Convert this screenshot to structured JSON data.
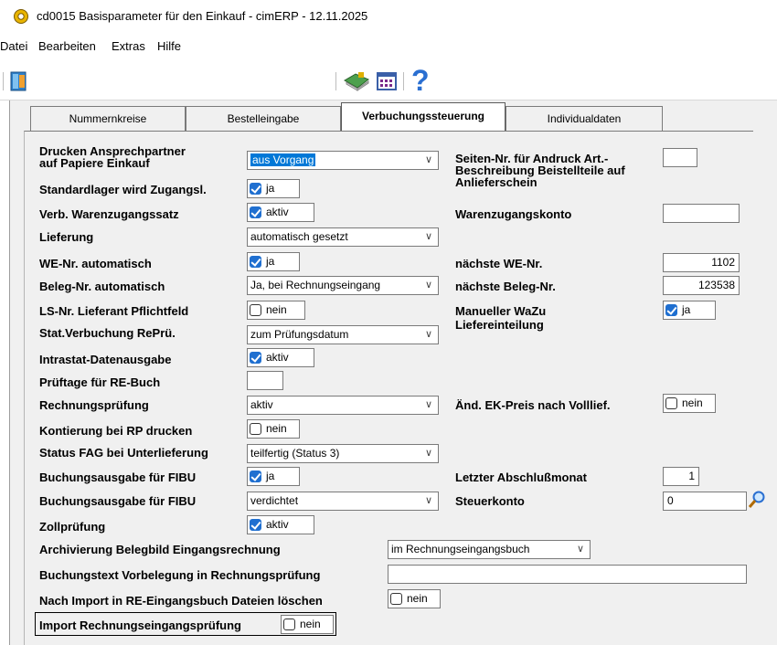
{
  "window": {
    "title": "cd0015 Basisparameter für den Einkauf - cimERP - 12.11.2025",
    "icon": "gear-icon"
  },
  "menu": [
    "Datei",
    "Bearbeiten",
    "Extras",
    "Hilfe"
  ],
  "toolbar": {
    "exit_icon": "exit-door-icon",
    "book_icon": "book-icon",
    "grid_icon": "grid-icon",
    "help_icon": "help-icon",
    "help_label": "?"
  },
  "tabs": [
    "Nummernkreise",
    "Bestelleingabe",
    "Verbuchungssteuerung",
    "Individualdaten"
  ],
  "active_tab": "Verbuchungssteuerung",
  "left": {
    "drucken": {
      "label": "Drucken Ansprechpartner\nauf Papiere Einkauf",
      "value": "aus Vorgang"
    },
    "standardlager": {
      "label": "Standardlager wird Zugangsl.",
      "value": "ja",
      "checked": true
    },
    "verb_warenzugang": {
      "label": "Verb. Warenzugangssatz",
      "value": "aktiv",
      "checked": true
    },
    "lieferung": {
      "label": "Lieferung",
      "value": "automatisch gesetzt"
    },
    "we_nr_auto": {
      "label": "WE-Nr. automatisch",
      "value": "ja",
      "checked": true
    },
    "beleg_nr_auto": {
      "label": "Beleg-Nr. automatisch",
      "value": "Ja, bei Rechnungseingang"
    },
    "ls_nr": {
      "label": "LS-Nr. Lieferant Pflichtfeld",
      "value": "nein",
      "checked": false
    },
    "stat_verbuchung": {
      "label": "Stat.Verbuchung RePrü.",
      "value": "zum Prüfungsdatum"
    },
    "intrastat": {
      "label": "Intrastat-Datenausgabe",
      "value": "aktiv",
      "checked": true
    },
    "prueftage": {
      "label": "Prüftage für RE-Buch",
      "value": ""
    },
    "rechnungspruefung": {
      "label": "Rechnungsprüfung",
      "value": "aktiv"
    },
    "kontierung": {
      "label": "Kontierung bei RP drucken",
      "value": "nein",
      "checked": false
    },
    "status_fag": {
      "label": "Status FAG bei Unterlieferung",
      "value": "teilfertig (Status 3)"
    },
    "buchungsausgabe1": {
      "label": "Buchungsausgabe für FIBU",
      "value": "ja",
      "checked": true
    },
    "buchungsausgabe2": {
      "label": "Buchungsausgabe für FIBU",
      "value": "verdichtet"
    },
    "zollpruefung": {
      "label": "Zollprüfung",
      "value": "aktiv",
      "checked": true
    },
    "archivierung": {
      "label": "Archivierung Belegbild Eingangsrechnung",
      "value": "im Rechnungseingangsbuch"
    },
    "buchungstext": {
      "label": "Buchungstext Vorbelegung in Rechnungsprüfung",
      "value": ""
    },
    "nach_import": {
      "label": "Nach Import in RE-Eingangsbuch Dateien löschen",
      "value": "nein",
      "checked": false
    },
    "import_rep": {
      "label": "Import Rechnungseingangsprüfung",
      "value": "nein",
      "checked": false
    }
  },
  "right": {
    "seiten_nr": {
      "label": "Seiten-Nr. für Andruck Art.-\nBeschreibung Beistellteile auf\nAnlieferschein",
      "value": ""
    },
    "warenzugangskonto": {
      "label": "Warenzugangskonto",
      "value": ""
    },
    "naechste_we": {
      "label": "nächste WE-Nr.",
      "value": "1102"
    },
    "naechste_beleg": {
      "label": "nächste Beleg-Nr.",
      "value": "123538"
    },
    "manueller_wazu": {
      "label": "Manueller WaZu\nLiefereinteilung",
      "value": "ja",
      "checked": true
    },
    "aend_ek_preis": {
      "label": "Änd. EK-Preis nach Volllief.",
      "value": "nein",
      "checked": false
    },
    "letzter_abschluss": {
      "label": "Letzter Abschlußmonat",
      "value": "1"
    },
    "steuerkonto": {
      "label": "Steuerkonto",
      "value": "0",
      "lookup_icon": "magnifier-icon"
    }
  }
}
